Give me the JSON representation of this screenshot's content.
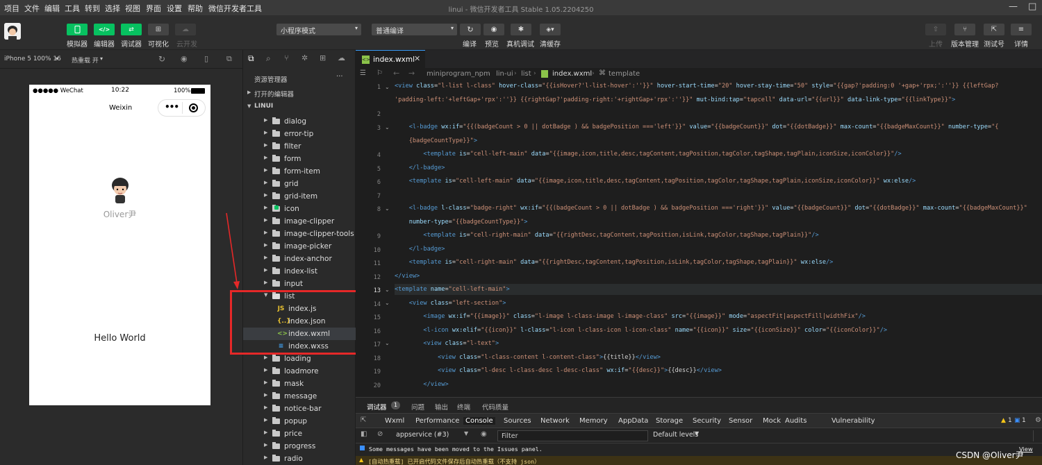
{
  "menubar": {
    "items": [
      "项目",
      "文件",
      "编辑",
      "工具",
      "转到",
      "选择",
      "视图",
      "界面",
      "设置",
      "帮助",
      "微信开发者工具"
    ],
    "title": "linui - 微信开发者工具 Stable 1.05.2204250"
  },
  "toolbar": {
    "simulator": "模拟器",
    "editor": "编辑器",
    "debugger": "调试器",
    "visual": "可视化",
    "cloud": "云开发",
    "mode_select": "小程序模式",
    "compile_select": "普通编译",
    "compile": "编译",
    "preview": "预览",
    "real_debug": "真机调试",
    "clear_cache": "清缓存",
    "upload": "上传",
    "version": "版本管理",
    "test_account": "测试号",
    "details": "详情"
  },
  "simulator": {
    "device": "iPhone 5 100% 16",
    "hot_reload": "热重载 开",
    "status_carrier": "●●●●● WeChat",
    "status_time": "10:22",
    "status_battery": "100%",
    "nav_title": "Weixin",
    "user_name": "Oliver尹",
    "hello": "Hello World"
  },
  "explorer": {
    "title": "资源管理器",
    "more": "···",
    "open_editors": "打开的编辑器",
    "root": "LINUI",
    "folders_top": [
      "dialog",
      "error-tip",
      "filter",
      "form",
      "form-item",
      "grid",
      "grid-item",
      "icon",
      "image-clipper",
      "image-clipper-tools",
      "image-picker",
      "index-anchor",
      "index-list",
      "input"
    ],
    "open_folder": "list",
    "files": [
      {
        "name": "index.js",
        "icon": "JS",
        "color": "#e8c12f"
      },
      {
        "name": "index.json",
        "icon": "{..}",
        "color": "#e8c12f"
      },
      {
        "name": "index.wxml",
        "icon": "<>",
        "color": "#8bc34a"
      },
      {
        "name": "index.wxss",
        "icon": "≡",
        "color": "#42a5f5"
      }
    ],
    "folders_bottom": [
      "loading",
      "loadmore",
      "mask",
      "message",
      "notice-bar",
      "popup",
      "price",
      "progress",
      "radio"
    ]
  },
  "editor": {
    "tab_name": "index.wxml",
    "breadcrumb": [
      "miniprogram_npm",
      "lin-ui",
      "list",
      "index.wxml",
      "template"
    ],
    "line_numbers": [
      "1",
      "",
      "2",
      "3",
      "",
      "4",
      "5",
      "6",
      "7",
      "8",
      "",
      "9",
      "10",
      "11",
      "12",
      "13",
      "14",
      "15",
      "16",
      "17",
      "18",
      "19",
      "20"
    ]
  },
  "devtools": {
    "top_tabs": [
      "调试器",
      "问题",
      "输出",
      "终端",
      "代码质量"
    ],
    "issue_badge": "1",
    "panels": [
      "Wxml",
      "Performance",
      "Console",
      "Sources",
      "Network",
      "Memory",
      "AppData",
      "Storage",
      "Security",
      "Sensor",
      "Mock",
      "Audits",
      "Vulnerability"
    ],
    "warn_count": "1",
    "err_count": "1",
    "context": "appservice (#3)",
    "filter_placeholder": "Filter",
    "levels": "Default levels",
    "msg1": "Some messages have been moved to the Issues panel.",
    "msg2": "[自动热重载] 已开启代码文件保存后自动热重载（不支持 json）",
    "view": "View",
    "watermark": "CSDN @Oliver尹"
  }
}
